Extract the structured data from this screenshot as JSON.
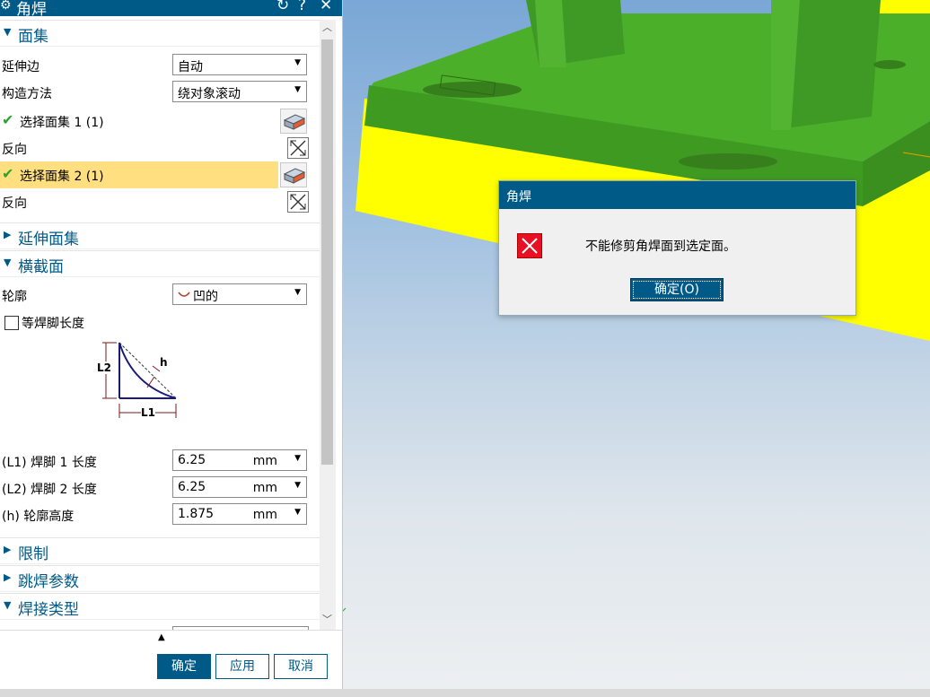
{
  "panel": {
    "title": "角焊",
    "title_icon": "gear-icon",
    "title_buttons": {
      "reset": "↻",
      "help": "?",
      "close": "✕"
    }
  },
  "sections": {
    "face_sets": "面集",
    "extend_face_sets": "延伸面集",
    "cross_section": "横截面",
    "limits": "限制",
    "skip_weld_params": "跳焊参数",
    "weld_type": "焊接类型"
  },
  "face_sets": {
    "extend_edge_label": "延伸边",
    "extend_edge_value": "自动",
    "construct_method_label": "构造方法",
    "construct_method_value": "绕对象滚动",
    "select_set1": "选择面集 1 (1)",
    "reverse1": "反向",
    "select_set2": "选择面集 2 (1)",
    "reverse2": "反向"
  },
  "cross_section": {
    "profile_label": "轮廓",
    "profile_value": "凹的",
    "equal_leg_label": "等焊脚长度",
    "equal_leg_checked": false,
    "diagram": {
      "l1": "L1",
      "l2": "L2",
      "h": "h"
    },
    "leg1_label": "(L1) 焊脚 1 长度",
    "leg1_value": "6.25",
    "leg2_label": "(L2) 焊脚 2 长度",
    "leg2_value": "6.25",
    "height_label": "(h) 轮廓高度",
    "height_value": "1.875",
    "unit": "mm"
  },
  "footer": {
    "ok": "确定",
    "apply": "应用",
    "cancel": "取消"
  },
  "dialog": {
    "title": "角焊",
    "message": "不能修剪角焊面到选定面。",
    "ok": "确定(O)"
  },
  "colors": {
    "accent": "#005a87",
    "highlight": "#ffdf80",
    "model_green": "#4caf2a",
    "model_yellow": "#ffff00"
  }
}
